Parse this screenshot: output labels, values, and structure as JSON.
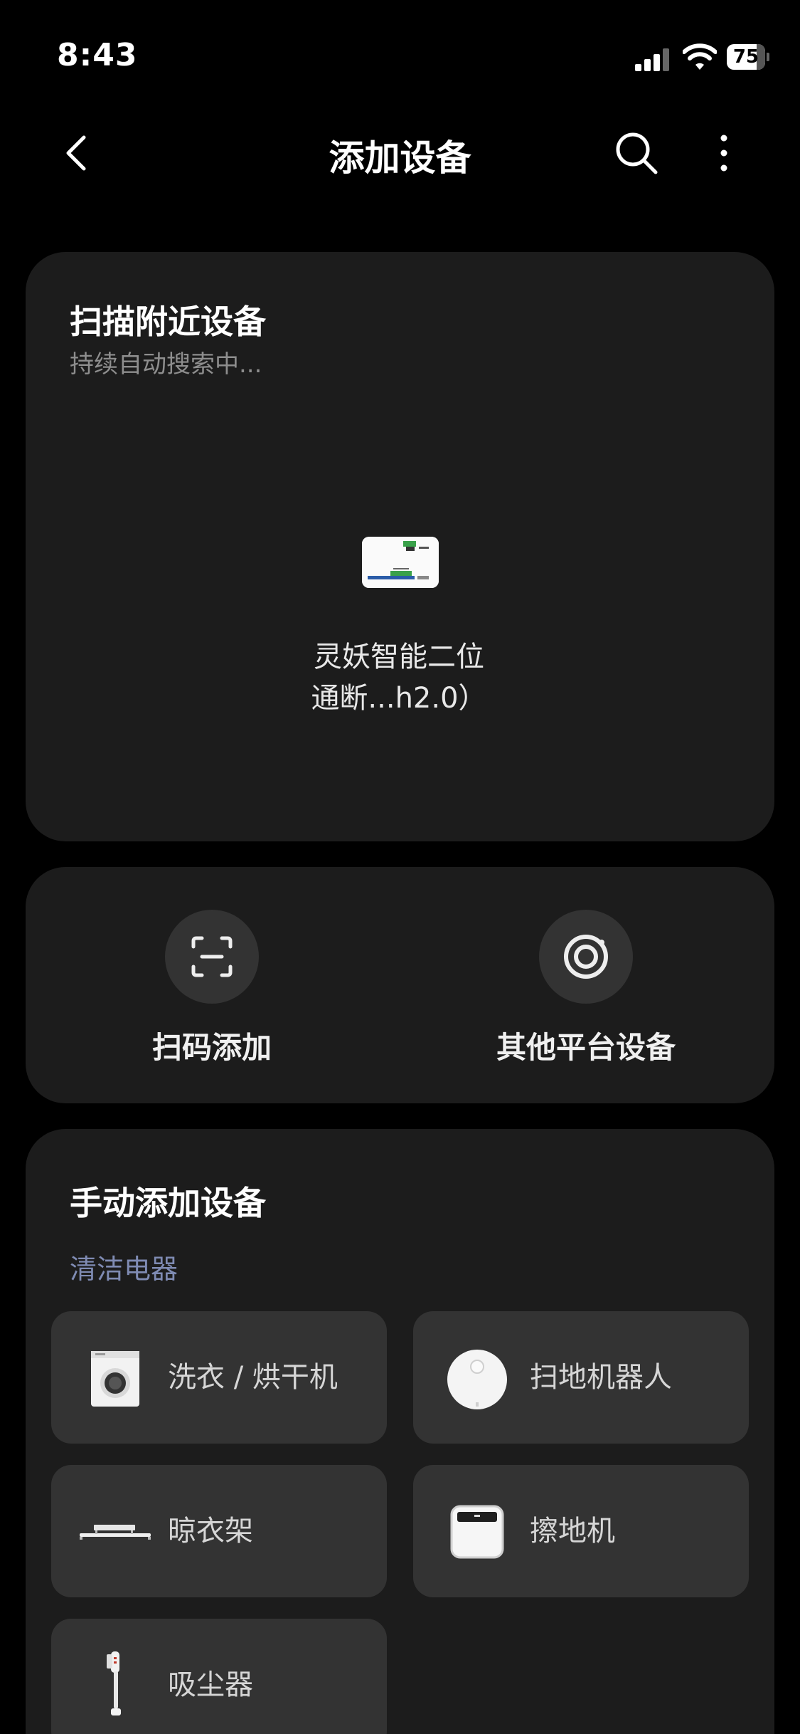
{
  "status": {
    "time": "8:43",
    "battery": "75",
    "battery_level": 0.75
  },
  "nav": {
    "title": "添加设备",
    "icons": [
      "chevron-left-icon",
      "search-icon",
      "more-vertical-icon"
    ]
  },
  "scan": {
    "title": "扫描附近设备",
    "subtitle": "持续自动搜索中...",
    "device_name_line1": "灵妖智能二位",
    "device_name_line2": "通断...h2.0）"
  },
  "actions": {
    "scan_code_label": "扫码添加",
    "other_platform_label": "其他平台设备"
  },
  "manual": {
    "title": "手动添加设备",
    "category": "清洁电器",
    "items": [
      {
        "label": "洗衣 / 烘干机",
        "icon": "washing-machine-icon"
      },
      {
        "label": "扫地机器人",
        "icon": "robot-vacuum-icon"
      },
      {
        "label": "晾衣架",
        "icon": "clothes-rack-icon"
      },
      {
        "label": "擦地机",
        "icon": "floor-washer-icon"
      },
      {
        "label": "吸尘器",
        "icon": "vacuum-cleaner-icon"
      }
    ]
  },
  "colors": {
    "background": "#000000",
    "card": "#1c1c1c",
    "tile": "#333333",
    "category_accent": "#7f8bb3"
  }
}
